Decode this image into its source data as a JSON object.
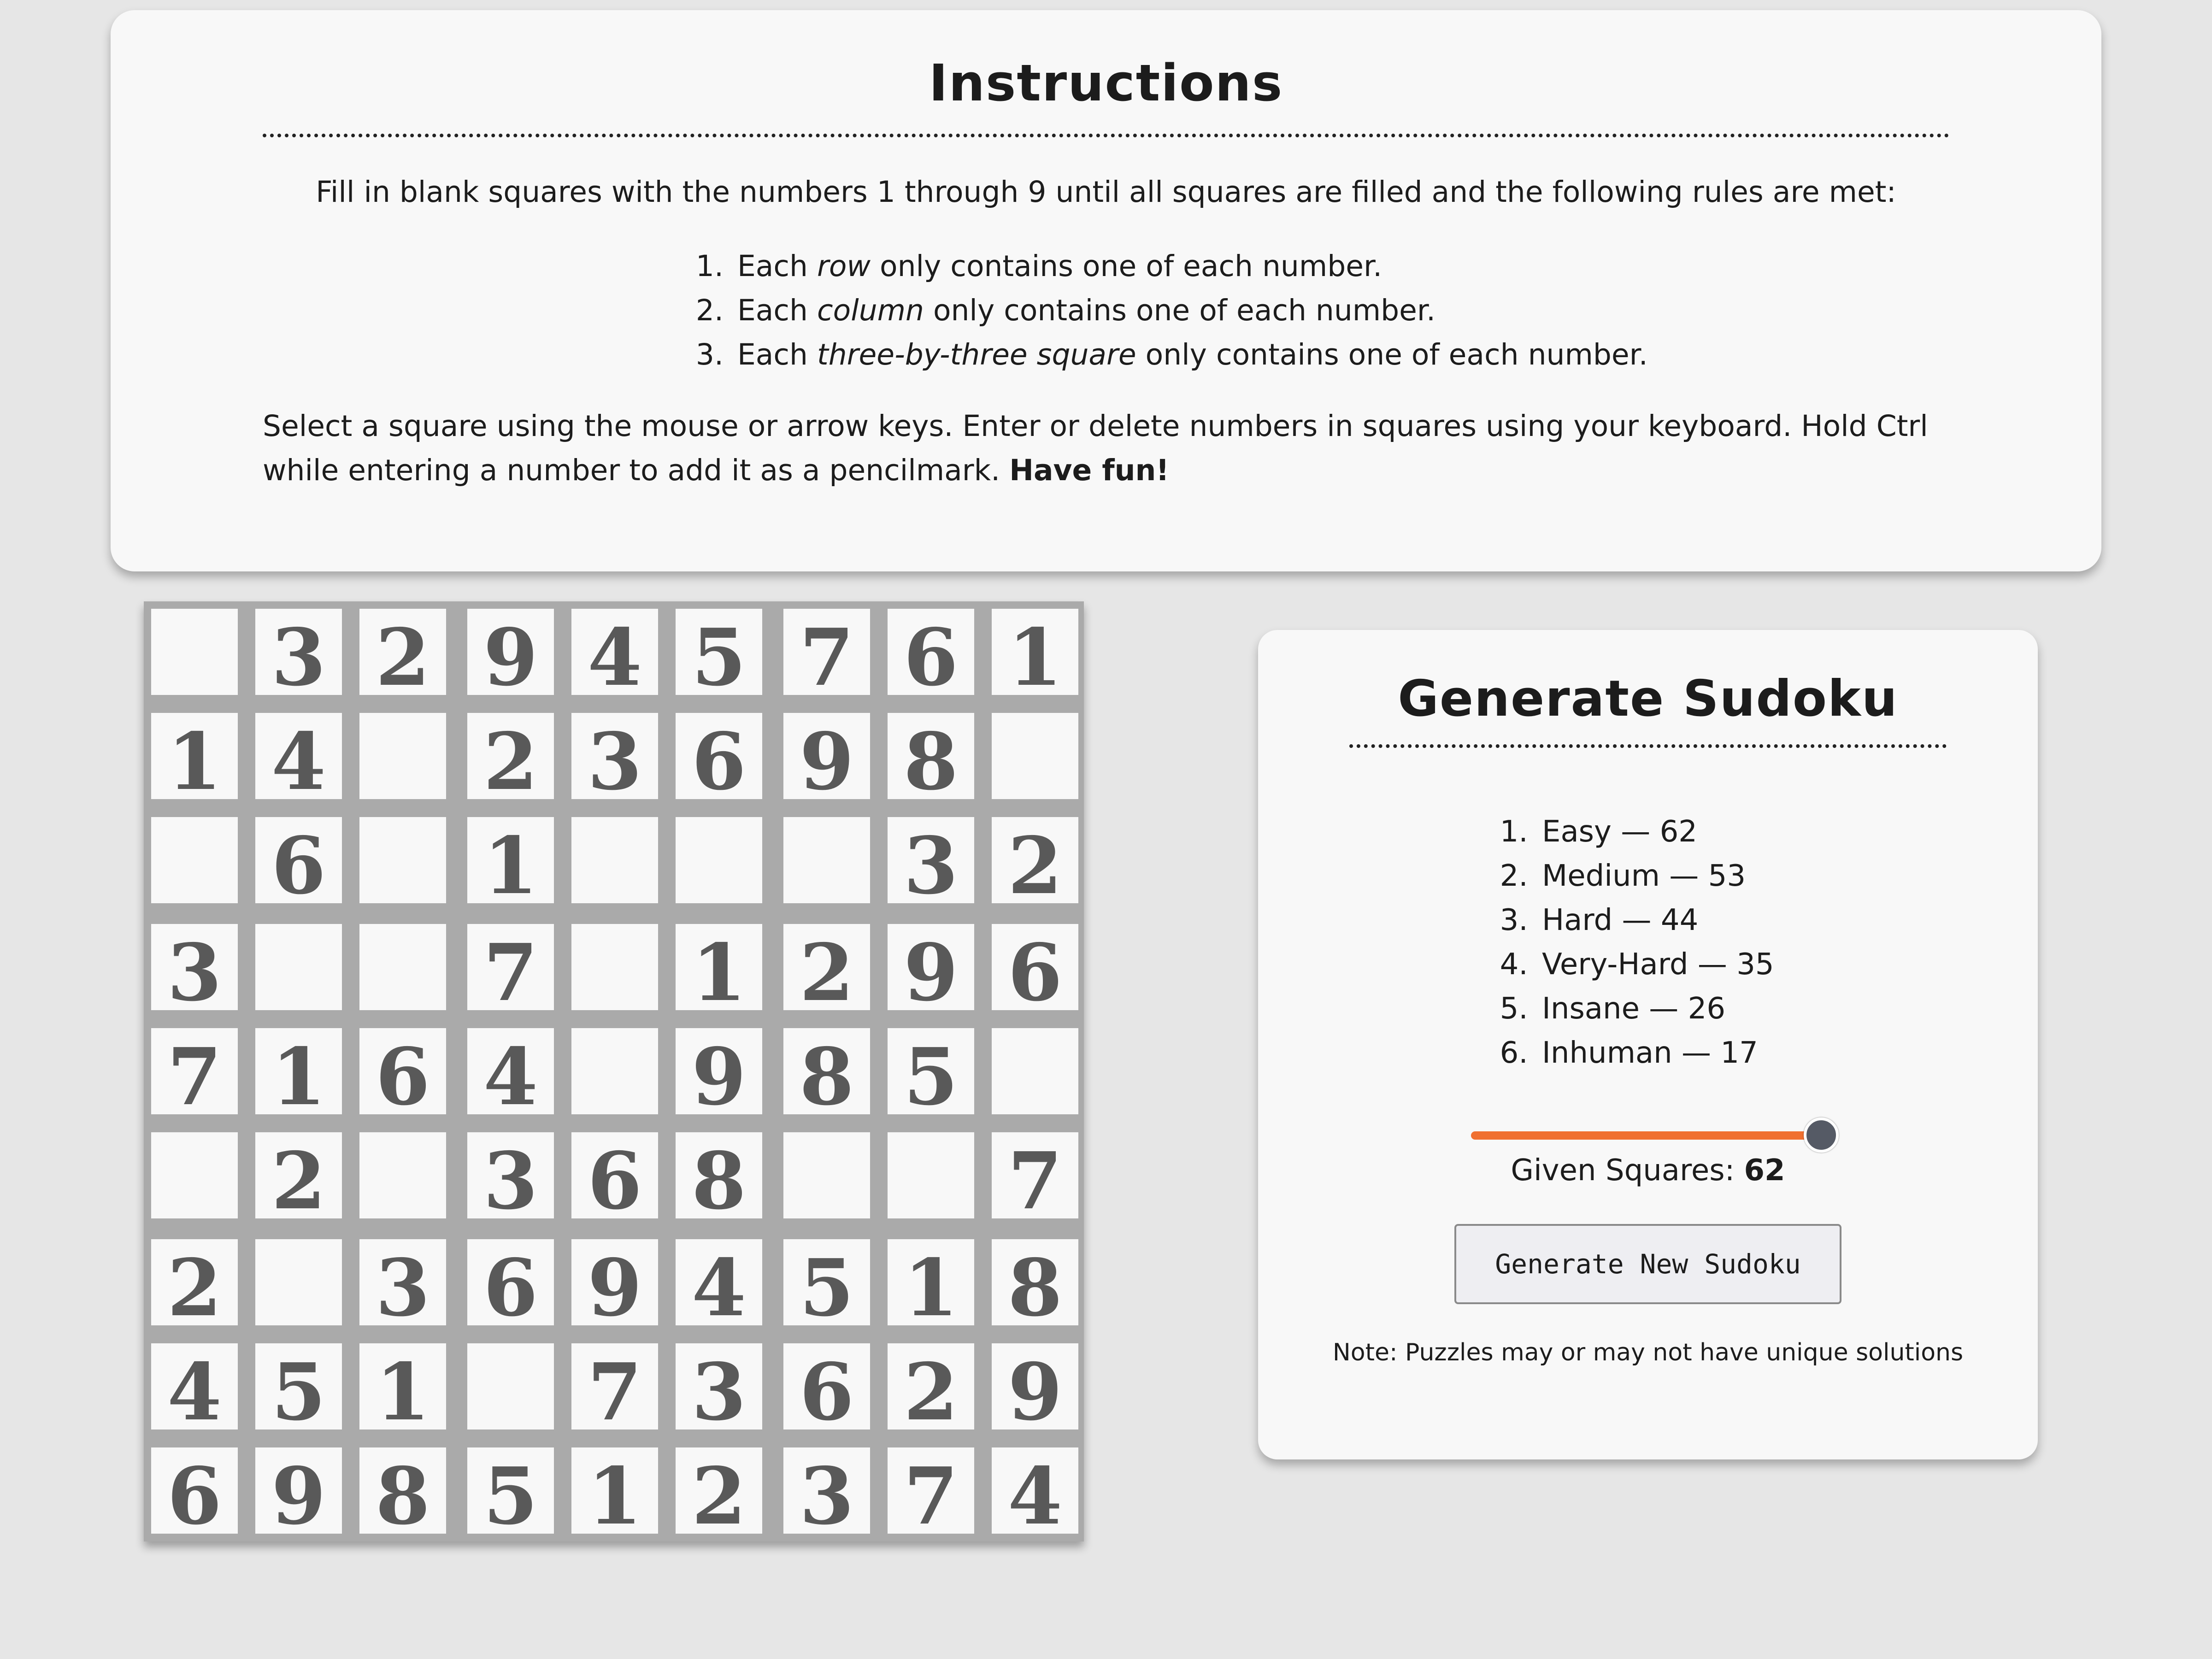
{
  "instructions": {
    "title": "Instructions",
    "intro": "Fill in blank squares with the numbers 1 through 9 until all squares are filled and the following rules are met:",
    "rules": [
      {
        "prefix": "Each ",
        "emphasis": "row",
        "suffix": " only contains one of each number."
      },
      {
        "prefix": "Each ",
        "emphasis": "column",
        "suffix": " only contains one of each number."
      },
      {
        "prefix": "Each ",
        "emphasis": "three-by-three square",
        "suffix": " only contains one of each number."
      }
    ],
    "outro": "Select a square using the mouse or arrow keys. Enter or delete numbers in squares using your keyboard. Hold Ctrl while entering a number to add it as a pencilmark.",
    "outro_bold": "Have fun!"
  },
  "board": {
    "cells": [
      [
        "",
        "3",
        "2",
        "9",
        "4",
        "5",
        "7",
        "6",
        "1"
      ],
      [
        "1",
        "4",
        "",
        "2",
        "3",
        "6",
        "9",
        "8",
        ""
      ],
      [
        "",
        "6",
        "",
        "1",
        "",
        "",
        "",
        "3",
        "2"
      ],
      [
        "3",
        "",
        "",
        "7",
        "",
        "1",
        "2",
        "9",
        "6"
      ],
      [
        "7",
        "1",
        "6",
        "4",
        "",
        "9",
        "8",
        "5",
        ""
      ],
      [
        "",
        "2",
        "",
        "3",
        "6",
        "8",
        "",
        "",
        "7"
      ],
      [
        "2",
        "",
        "3",
        "6",
        "9",
        "4",
        "5",
        "1",
        "8"
      ],
      [
        "4",
        "5",
        "1",
        "",
        "7",
        "3",
        "6",
        "2",
        "9"
      ],
      [
        "6",
        "9",
        "8",
        "5",
        "1",
        "2",
        "3",
        "7",
        "4"
      ]
    ]
  },
  "generator": {
    "title": "Generate Sudoku",
    "difficulties": [
      {
        "label": "Easy",
        "sep": " — ",
        "count": "62"
      },
      {
        "label": "Medium",
        "sep": " — ",
        "count": "53"
      },
      {
        "label": "Hard",
        "sep": " — ",
        "count": "44"
      },
      {
        "label": "Very-Hard",
        "sep": " — ",
        "count": "35"
      },
      {
        "label": "Insane",
        "sep": " — ",
        "count": "26"
      },
      {
        "label": "Inhuman",
        "sep": " — ",
        "count": "17"
      }
    ],
    "slider": {
      "min": 17,
      "max": 62,
      "value": 62
    },
    "given_label": "Given Squares: ",
    "given_value": "62",
    "button_label": "Generate New Sudoku",
    "note": "Note: Puzzles may or may not have unique solutions",
    "accent_color": "#f07030",
    "thumb_color": "#555a65"
  }
}
